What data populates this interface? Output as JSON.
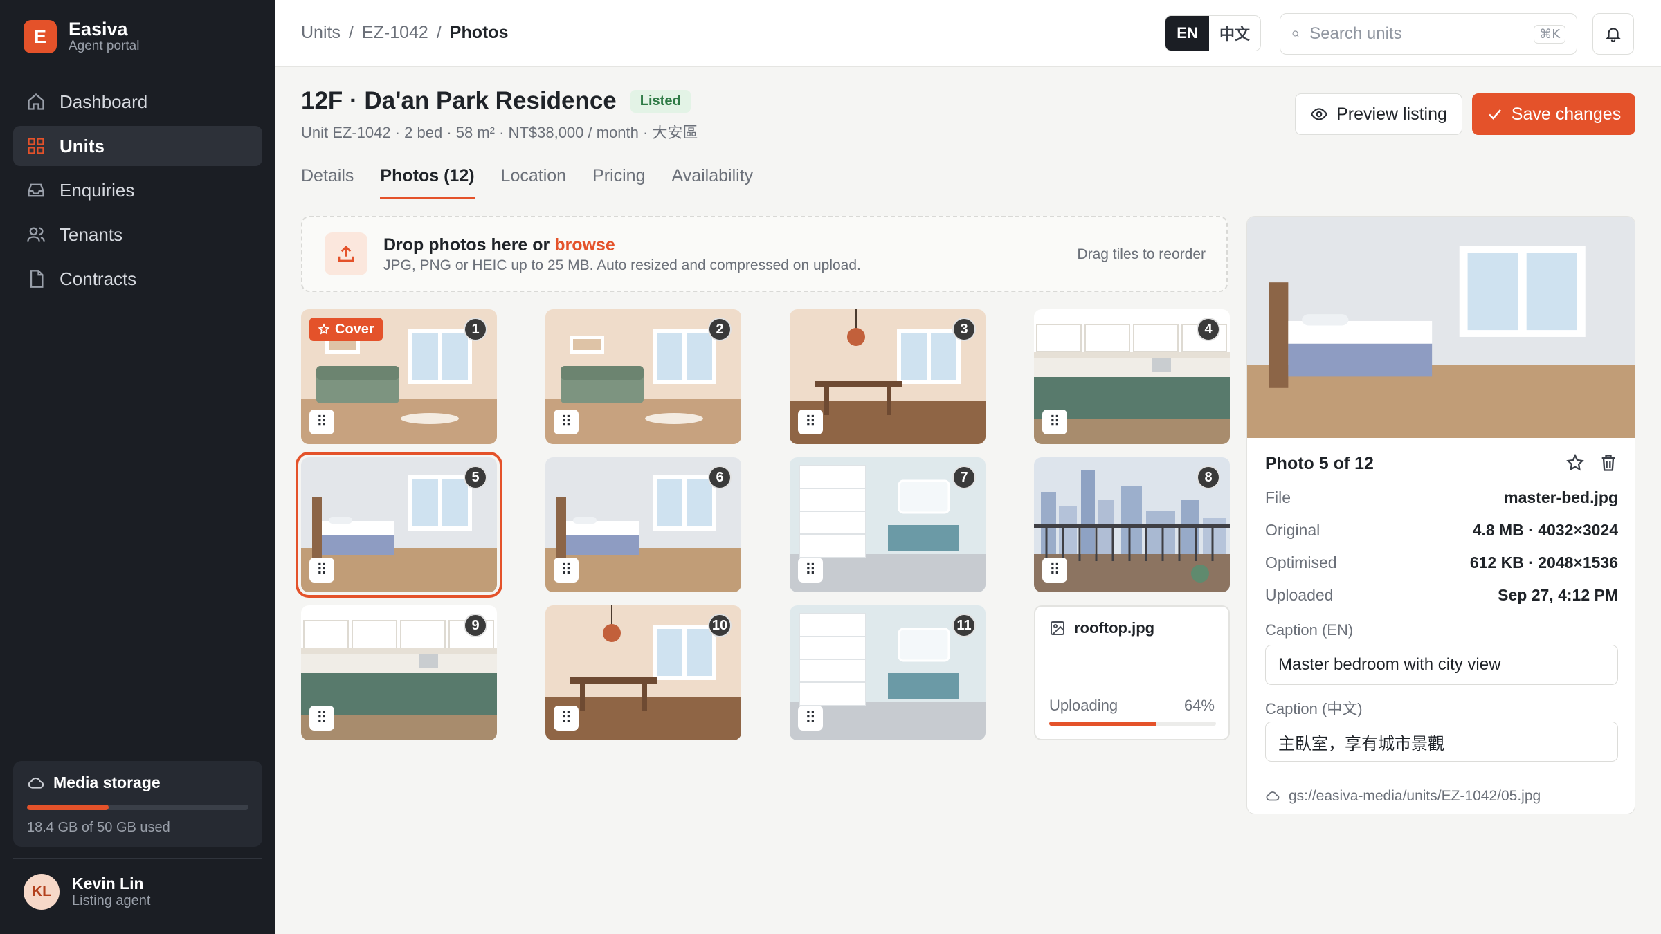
{
  "brand": {
    "initial": "E",
    "name": "Easiva",
    "subtitle": "Agent portal"
  },
  "nav": [
    {
      "label": "Dashboard",
      "icon": "home-icon",
      "active": false
    },
    {
      "label": "Units",
      "icon": "grid-icon",
      "active": true
    },
    {
      "label": "Enquiries",
      "icon": "inbox-icon",
      "active": false
    },
    {
      "label": "Tenants",
      "icon": "users-icon",
      "active": false
    },
    {
      "label": "Contracts",
      "icon": "file-icon",
      "active": false
    }
  ],
  "storage": {
    "title": "Media storage",
    "used_text": "18.4 GB of 50 GB used",
    "fraction": 0.368
  },
  "user": {
    "initials": "KL",
    "name": "Kevin Lin",
    "role": "Listing agent"
  },
  "breadcrumb": {
    "root": "Units",
    "unit": "EZ-1042",
    "current": "Photos",
    "sep": "/"
  },
  "lang": {
    "active": "EN",
    "other": "中文"
  },
  "search": {
    "placeholder": "Search units",
    "shortcut": "⌘K"
  },
  "header": {
    "title": "12F · Da'an Park Residence",
    "status": "Listed",
    "subtitle": "Unit EZ-1042 · 2 bed · 58 m² · NT$38,000 / month · 大安區",
    "preview_label": "Preview listing",
    "save_label": "Save changes"
  },
  "tabs": [
    {
      "label": "Details",
      "active": false
    },
    {
      "label": "Photos (12)",
      "active": true
    },
    {
      "label": "Location",
      "active": false
    },
    {
      "label": "Pricing",
      "active": false
    },
    {
      "label": "Availability",
      "active": false
    }
  ],
  "dropzone": {
    "title": "Drop photos here or ",
    "link": "browse",
    "subtitle": "JPG, PNG or HEIC up to 25 MB. Auto resized and compressed on upload.",
    "hint": "Drag tiles to reorder"
  },
  "photos": [
    {
      "n": "1",
      "scene": "living",
      "cover": true
    },
    {
      "n": "2",
      "scene": "living",
      "cover": false
    },
    {
      "n": "3",
      "scene": "dining",
      "cover": false
    },
    {
      "n": "4",
      "scene": "kitchen",
      "cover": false
    },
    {
      "n": "5",
      "scene": "bedroom",
      "cover": false,
      "selected": true
    },
    {
      "n": "6",
      "scene": "bedroom",
      "cover": false
    },
    {
      "n": "7",
      "scene": "bath",
      "cover": false
    },
    {
      "n": "8",
      "scene": "balcony",
      "cover": false
    },
    {
      "n": "9",
      "scene": "kitchen",
      "cover": false
    },
    {
      "n": "10",
      "scene": "dining",
      "cover": false
    },
    {
      "n": "11",
      "scene": "bath",
      "cover": false
    }
  ],
  "cover_label": "Cover",
  "handle_glyph": "⠿",
  "uploading": {
    "file": "rooftop.jpg",
    "label": "Uploading",
    "percent": "64%",
    "fraction": 0.64
  },
  "detail": {
    "title": "Photo 5 of 12",
    "rows": [
      {
        "k": "File",
        "v": "master-bed.jpg"
      },
      {
        "k": "Original",
        "v": "4.8 MB · 4032×3024"
      },
      {
        "k": "Optimised",
        "v": "612 KB · 2048×1536"
      },
      {
        "k": "Uploaded",
        "v": "Sep 27, 4:12 PM"
      }
    ],
    "caption_en_label": "Caption (EN)",
    "caption_en": "Master bedroom with city view",
    "caption_zh_label": "Caption (中文)",
    "caption_zh": "主臥室，享有城市景觀",
    "path": "gs://easiva-media/units/EZ-1042/05.jpg"
  },
  "colors": {
    "accent": "#e4522a",
    "sidebar": "#1b1e24",
    "listed_bg": "#e3f3e6",
    "listed_text": "#2e7a45"
  }
}
